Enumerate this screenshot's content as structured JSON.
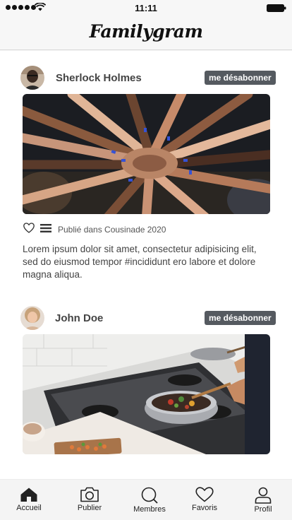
{
  "status_bar": {
    "time": "11:11"
  },
  "header": {
    "logo": "Familygram"
  },
  "feed": {
    "posts": [
      {
        "author": "Sherlock Holmes",
        "unsubscribe_label": "me désabonner",
        "published_in": "Publié dans Cousinade 2020",
        "text": "Lorem ipsum dolor sit amet, consectetur adipisicing elit, sed do eiusmod tempor #incididunt ero labore et dolore magna aliqua."
      },
      {
        "author": "John Doe",
        "unsubscribe_label": "me désabonner"
      }
    ]
  },
  "tab_bar": {
    "items": [
      {
        "label": "Accueil",
        "icon": "home-icon",
        "active": true
      },
      {
        "label": "Publier",
        "icon": "camera-icon"
      },
      {
        "label": "Membres",
        "icon": "search-icon"
      },
      {
        "label": "Favoris",
        "icon": "heart-icon"
      },
      {
        "label": "Profil",
        "icon": "user-icon"
      }
    ]
  },
  "colors": {
    "badge": "#555a60",
    "text": "#444444",
    "background": "#ffffff"
  }
}
